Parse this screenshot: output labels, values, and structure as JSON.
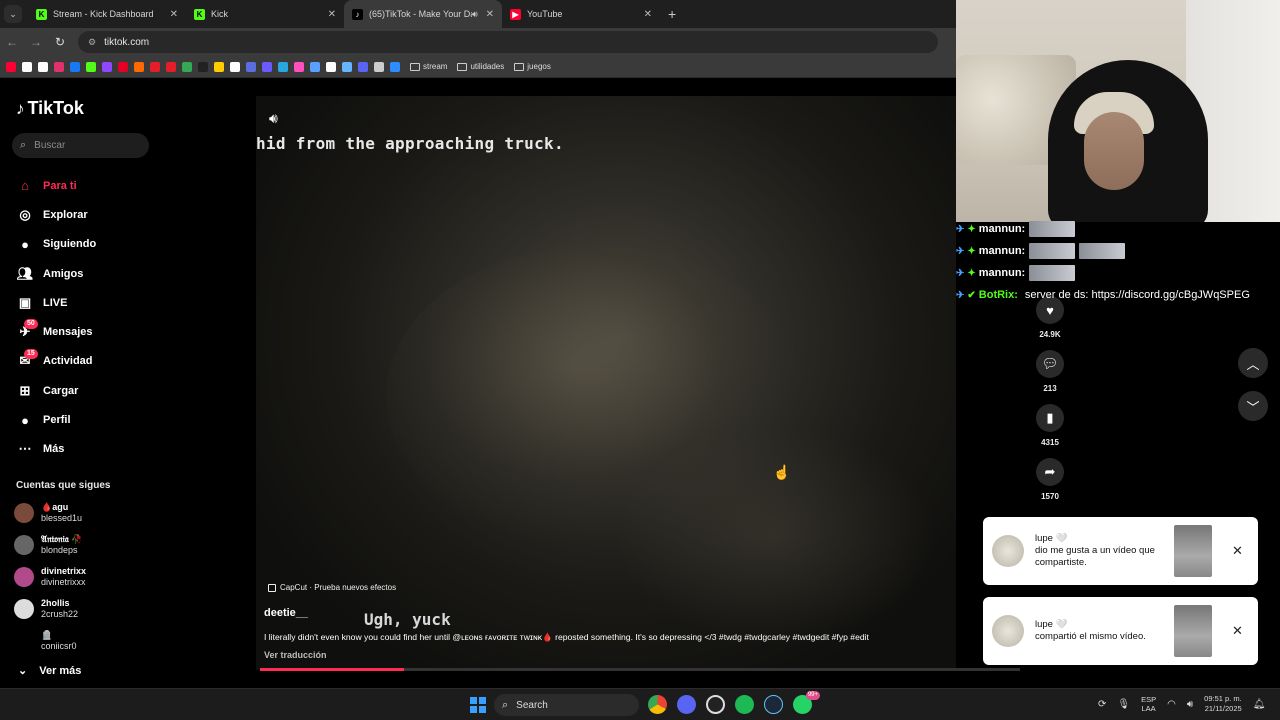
{
  "tabs": [
    {
      "title": "Stream - Kick Dashboard",
      "icon": "kick-icon",
      "color": "#53fc18"
    },
    {
      "title": "Kick",
      "icon": "kick-icon",
      "color": "#53fc18"
    },
    {
      "title": "(65)TikTok - Make Your Day",
      "icon": "tiktok-icon",
      "color": "#ffffff",
      "active": true,
      "audio": true
    },
    {
      "title": "YouTube",
      "icon": "youtube-icon",
      "color": "#ff0033"
    }
  ],
  "address": {
    "url": "tiktok.com"
  },
  "bookmarks": {
    "folders": [
      "stream",
      "utilidades",
      "juegos"
    ],
    "icon_colors": [
      "#ff0033",
      "#ffffff",
      "#ffffff",
      "#e1306c",
      "#1877f2",
      "#53fc18",
      "#9146ff",
      "#e60023",
      "#ff6a00",
      "#e41e26",
      "#e41e26",
      "#34a853",
      "#222",
      "#ffcc00",
      "#ffffff",
      "#5b6ee1",
      "#6b5bff",
      "#2aa7e0",
      "#ff4fbd",
      "#5aa0ff",
      "#ffffff",
      "#66b3ff",
      "#5865f2",
      "#cccccc",
      "#2d8cff"
    ]
  },
  "tiktok": {
    "logo": "TikTok",
    "search_placeholder": "Buscar",
    "menu": [
      {
        "label": "Para ti",
        "icon": "home-icon",
        "active": true
      },
      {
        "label": "Explorar",
        "icon": "compass-icon"
      },
      {
        "label": "Siguiendo",
        "icon": "following-avatar-icon"
      },
      {
        "label": "Amigos",
        "icon": "friends-icon"
      },
      {
        "label": "LIVE",
        "icon": "live-icon"
      },
      {
        "label": "Mensajes",
        "icon": "messages-icon",
        "badge": "50"
      },
      {
        "label": "Actividad",
        "icon": "activity-icon",
        "badge": "15"
      },
      {
        "label": "Cargar",
        "icon": "upload-icon"
      },
      {
        "label": "Perfil",
        "icon": "profile-icon"
      },
      {
        "label": "Más",
        "icon": "more-icon"
      }
    ],
    "following_title": "Cuentas que sigues",
    "following": [
      {
        "name": "🩸agu",
        "handle": "blessed1u",
        "color": "#7a4a3a"
      },
      {
        "name": "𝔄𝔫𝔱𝔬𝔫𝔦𝔞 🥀",
        "handle": "blondeps",
        "color": "#666"
      },
      {
        "name": "divinetrixx",
        "handle": "divinetrixxx",
        "color": "#b04a8a"
      },
      {
        "name": "2hollis",
        "handle": "2crush22",
        "color": "#ddd",
        "verified": true
      },
      {
        "name": "🪦",
        "handle": "coniicsr0",
        "color": "#000"
      }
    ],
    "ver_mas": "Ver más"
  },
  "video": {
    "subtitle_top": "hid from the approaching truck.",
    "subtitle_bottom": "Ugh, yuck",
    "capcut": "CapCut · Prueba nuevos efectos",
    "author": "deetie__",
    "description": "I literally didn't even know you could find her until @ʟᴇᴏɴs ғᴀᴠᴏʀɪᴛᴇ ᴛᴡɪɴᴋ🩸 reposted something. It's so depressing </3 #twdg #twdgcarley #twdgedit #fyp #edit",
    "translate": "Ver traducción",
    "progress": 0.19
  },
  "actions": [
    {
      "icon": "heart-icon",
      "count": "24.9K"
    },
    {
      "icon": "comment-icon",
      "count": "213"
    },
    {
      "icon": "bookmark-icon",
      "count": "4315"
    },
    {
      "icon": "share-icon",
      "count": "1570"
    }
  ],
  "chat": [
    {
      "user": "mannun:",
      "emotes": 1
    },
    {
      "user": "mannun:",
      "emotes": 2
    },
    {
      "user": "mannun:",
      "emotes": 1
    },
    {
      "user": "BotRix:",
      "bot": true,
      "message": "server de ds: https://discord.gg/cBgJWqSPEG"
    }
  ],
  "notifications": [
    {
      "user": "lupe 🤍",
      "text": "dio me gusta a un vídeo que compartiste."
    },
    {
      "user": "lupe 🤍",
      "text": "compartió el mismo vídeo."
    }
  ],
  "taskbar": {
    "search": "Search",
    "lang_top": "ESP",
    "lang_bottom": "LAA",
    "time": "09:51 p. m.",
    "date": "21/11/2025",
    "whatsapp_badge": "99+"
  }
}
